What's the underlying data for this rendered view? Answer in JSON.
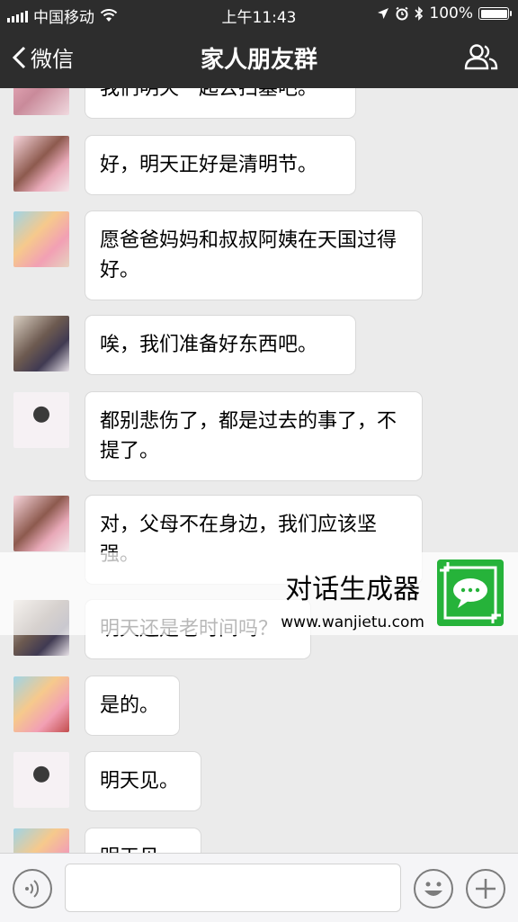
{
  "status_bar": {
    "carrier": "中国移动",
    "time": "上午11:43",
    "battery": "100%"
  },
  "nav": {
    "back_label": "微信",
    "title": "家人朋友群"
  },
  "messages": [
    {
      "text": "我们明天一起去扫墓吧。",
      "avatar": "avatar-pink-hair"
    },
    {
      "text": "好，明天正好是清明节。",
      "avatar": "avatar-brown-hair"
    },
    {
      "text": "愿爸爸妈妈和叔叔阿姨在天国过得好。",
      "avatar": "avatar-blonde-flowers"
    },
    {
      "text": "唉，我们准备好东西吧。",
      "avatar": "avatar-dark-dress"
    },
    {
      "text": "都别悲伤了，都是过去的事了，不提了。",
      "avatar": "avatar-twin-tails"
    },
    {
      "text": "对，父母不在身边，我们应该坚强。",
      "avatar": "avatar-brown-hair"
    },
    {
      "text": "明天还是老时间吗？",
      "avatar": "avatar-dark-dress"
    },
    {
      "text": "是的。",
      "avatar": "avatar-blonde-flowers"
    },
    {
      "text": "明天见。",
      "avatar": "avatar-twin-tails"
    },
    {
      "text": "明天见。",
      "avatar": "avatar-blonde-flowers"
    }
  ],
  "watermark": {
    "title": "对话生成器",
    "url": "www.wanjietu.com"
  },
  "colors": {
    "nav_bg": "#2d2d2d",
    "chat_bg": "#ebebeb",
    "bubble": "#ffffff",
    "logo_green": "#26b33a"
  }
}
